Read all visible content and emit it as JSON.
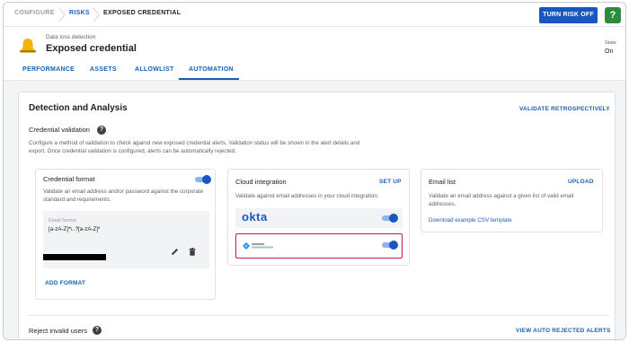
{
  "breadcrumb": {
    "items": [
      "CONFIGURE",
      "RISKS",
      "EXPOSED CREDENTIAL"
    ]
  },
  "toolbar": {
    "turn_risk_off_label": "TURN RISK OFF",
    "help_label": "?"
  },
  "header": {
    "subtitle": "Data loss detection",
    "title": "Exposed credential",
    "state_label": "State",
    "state_value": "On"
  },
  "tabs": [
    {
      "label": "PERFORMANCE",
      "active": false
    },
    {
      "label": "ASSETS",
      "active": false
    },
    {
      "label": "ALLOWLIST",
      "active": false
    },
    {
      "label": "AUTOMATION",
      "active": true
    }
  ],
  "detection": {
    "title": "Detection and Analysis",
    "validate_retro_label": "VALIDATE RETROSPECTIVELY",
    "credential_validation_label": "Credential validation",
    "help_label": "?",
    "description": "Configure a method of validation to check against new exposed credential alerts. Validation status will be shown in the alert details and export. Once credential validation is configured, alerts can be automatically rejected."
  },
  "credential_format": {
    "title": "Credential format",
    "enabled": true,
    "description": "Validate an email address and/or password against the corporate standard and requirements.",
    "email_format_label": "Email format",
    "email_format_value": "[a-zA-Z]*\\..?[a-zA-Z]*",
    "add_format_label": "ADD FORMAT"
  },
  "cloud_integration": {
    "title": "Cloud integration",
    "setup_label": "SET UP",
    "description": "Validate against email addresses in your cloud integration.",
    "integrations": [
      {
        "name": "okta",
        "enabled": true
      },
      {
        "name": "Azure Active Directory",
        "enabled": true
      }
    ]
  },
  "email_list": {
    "title": "Email list",
    "upload_label": "UPLOAD",
    "description": "Validate an email address against a given list of valid email addresses.",
    "csv_link_label": "Download example CSV template"
  },
  "reject": {
    "label": "Reject invalid users",
    "help_label": "?",
    "view_auto_rejected_label": "VIEW AUTO REJECTED ALERTS"
  },
  "colors": {
    "primary": "#1a56c2",
    "link": "#1a5fb4",
    "help_green": "#2e8b3d",
    "highlight": "#c2185b",
    "bell": "#f2b400"
  }
}
